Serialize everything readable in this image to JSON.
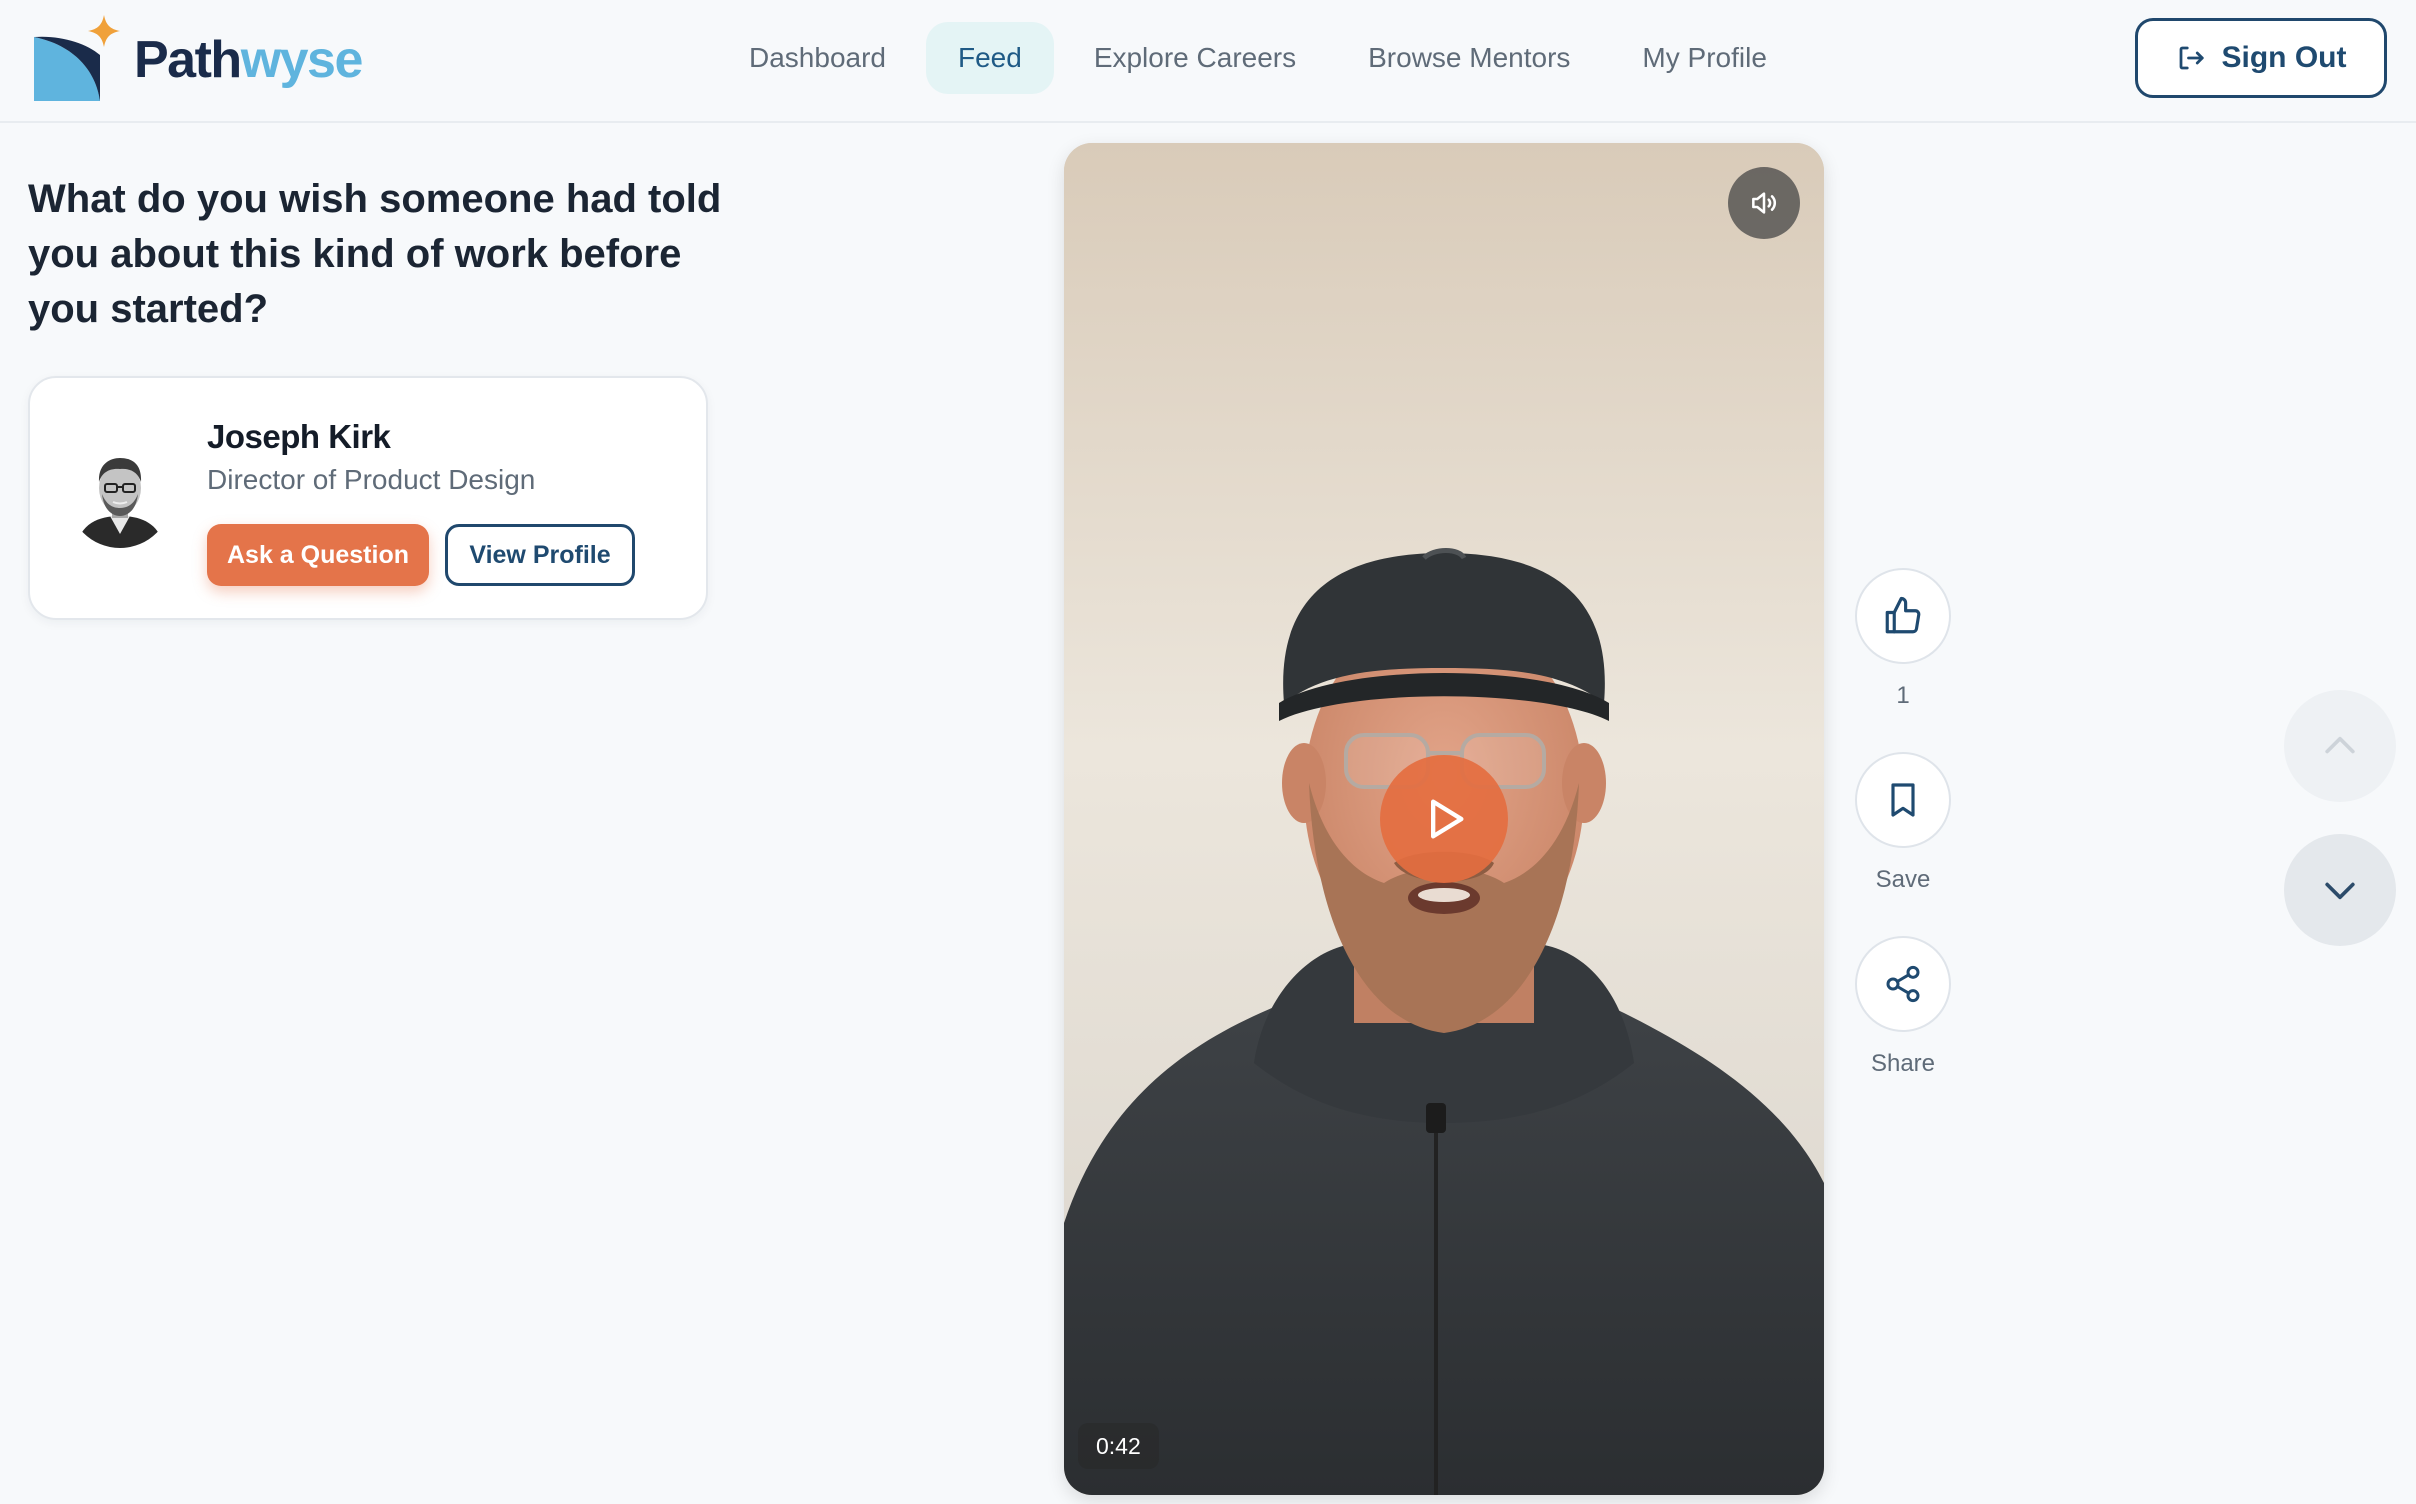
{
  "brand": {
    "name_part1": "Path",
    "name_part2": "wyse"
  },
  "nav": {
    "items": [
      {
        "label": "Dashboard"
      },
      {
        "label": "Feed",
        "active": true
      },
      {
        "label": "Explore Careers"
      },
      {
        "label": "Browse Mentors"
      },
      {
        "label": "My Profile"
      }
    ]
  },
  "header": {
    "sign_out_label": "Sign Out"
  },
  "feed": {
    "question": "What do you wish someone had told you about this kind of work before you started?",
    "mentor": {
      "name": "Joseph Kirk",
      "title": "Director of Product Design",
      "ask_label": "Ask a Question",
      "view_label": "View Profile"
    },
    "video": {
      "duration": "0:42"
    },
    "actions": {
      "like_count": "1",
      "save_label": "Save",
      "share_label": "Share"
    }
  },
  "colors": {
    "accent": "#e4744a",
    "primary": "#20486d",
    "brand_light": "#5fb4de",
    "nav_active_bg": "#e4f4f5"
  }
}
